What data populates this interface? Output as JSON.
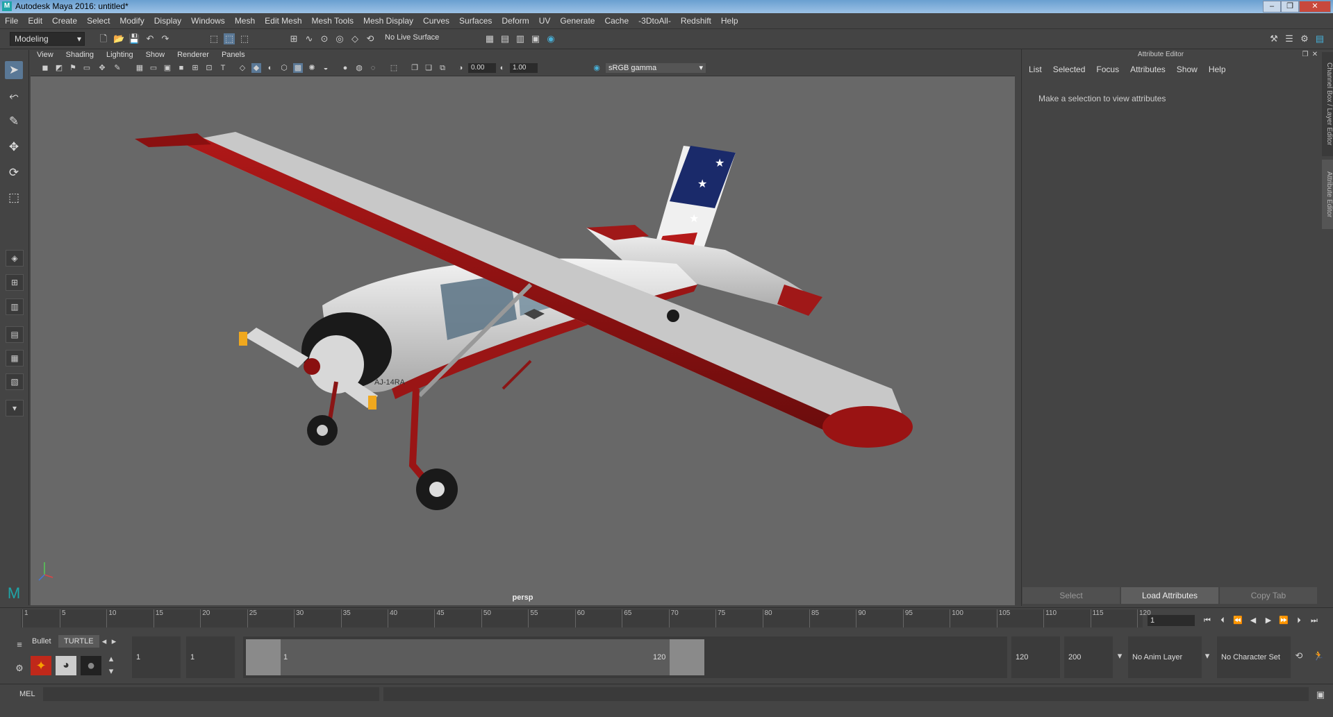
{
  "window": {
    "title": "Autodesk Maya 2016: untitled*",
    "minimize": "–",
    "restore": "❐",
    "close": "✕"
  },
  "menubar": [
    "File",
    "Edit",
    "Create",
    "Select",
    "Modify",
    "Display",
    "Windows",
    "Mesh",
    "Edit Mesh",
    "Mesh Tools",
    "Mesh Display",
    "Curves",
    "Surfaces",
    "Deform",
    "UV",
    "Generate",
    "Cache",
    "-3DtoAll-",
    "Redshift",
    "Help"
  ],
  "statusline": {
    "mode": "Modeling",
    "live_surface": "No Live Surface"
  },
  "viewport": {
    "menu": [
      "View",
      "Shading",
      "Lighting",
      "Show",
      "Renderer",
      "Panels"
    ],
    "exposure": "0.00",
    "gamma_value": "1.00",
    "color_space": "sRGB gamma",
    "camera_label": "persp",
    "model_text": "AJ-14RA"
  },
  "attribute_editor": {
    "title": "Attribute Editor",
    "menu": [
      "List",
      "Selected",
      "Focus",
      "Attributes",
      "Show",
      "Help"
    ],
    "message": "Make a selection to view attributes",
    "buttons": {
      "select": "Select",
      "load": "Load Attributes",
      "copy": "Copy Tab"
    },
    "side_tabs": [
      "Channel Box / Layer Editor",
      "Attribute Editor"
    ]
  },
  "time_slider": {
    "ticks": [
      1,
      5,
      10,
      15,
      20,
      25,
      30,
      35,
      40,
      45,
      50,
      55,
      60,
      65,
      70,
      75,
      80,
      85,
      90,
      95,
      100,
      105,
      110,
      115,
      120
    ],
    "current_frame": "1"
  },
  "range_slider": {
    "shelf_tabs": [
      "Bullet",
      "TURTLE"
    ],
    "start": "1",
    "anim_start": "1",
    "range_start_label": "1",
    "range_end_label": "120",
    "anim_end": "120",
    "end": "200",
    "anim_layer": "No Anim Layer",
    "character_set": "No Character Set"
  },
  "command_line": {
    "label": "MEL"
  }
}
